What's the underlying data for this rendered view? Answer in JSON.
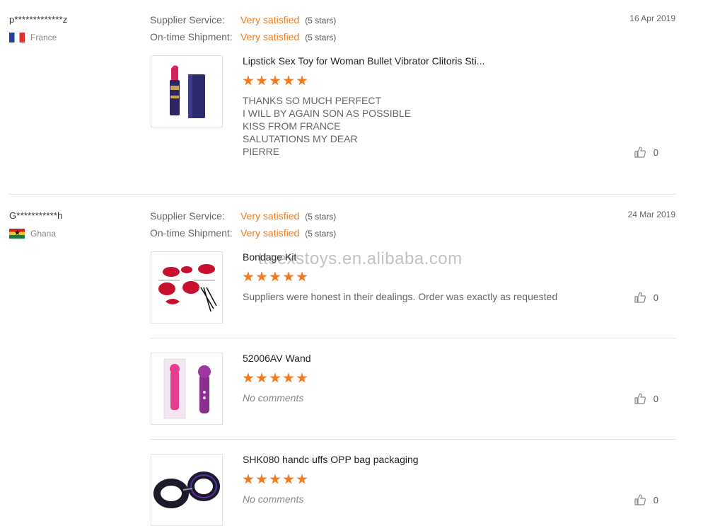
{
  "reviews": [
    {
      "user": "p*************z",
      "country": "France",
      "date": "16 Apr 2019",
      "supplier_service_label": "Supplier Service:",
      "supplier_service_value": "Very satisfied",
      "supplier_service_stars": "(5 stars)",
      "shipment_label": "On-time Shipment:",
      "shipment_value": "Very satisfied",
      "shipment_stars": "(5 stars)",
      "items": [
        {
          "title": "Lipstick Sex Toy for Woman Bullet Vibrator Clitoris Sti...",
          "rating": 5,
          "comment": "THANKS SO MUCH PERFECT\nI WILL BY AGAIN  SON AS POSSIBLE\nKISS FROM FRANCE\nSALUTATIONS MY DEAR\nPIERRE",
          "likes": "0"
        }
      ]
    },
    {
      "user": "G***********h",
      "country": "Ghana",
      "date": "24 Mar 2019",
      "supplier_service_label": "Supplier Service:",
      "supplier_service_value": "Very satisfied",
      "supplier_service_stars": "(5 stars)",
      "shipment_label": "On-time Shipment:",
      "shipment_value": "Very satisfied",
      "shipment_stars": "(5 stars)",
      "items": [
        {
          "title": "Bondage Kit",
          "rating": 5,
          "comment": "Suppliers were honest in their dealings. Order was exactly as requested",
          "likes": "0"
        },
        {
          "title": "52006AV Wand",
          "rating": 5,
          "comment": "No comments",
          "likes": "0"
        },
        {
          "title": "SHK080 handc uffs OPP bag packaging",
          "rating": 5,
          "comment": "No comments",
          "likes": "0"
        }
      ]
    }
  ],
  "watermark": "ttsexstoys.en.alibaba.com",
  "colors": {
    "accent": "#f37b1d",
    "divider": "#e3e3e3"
  }
}
